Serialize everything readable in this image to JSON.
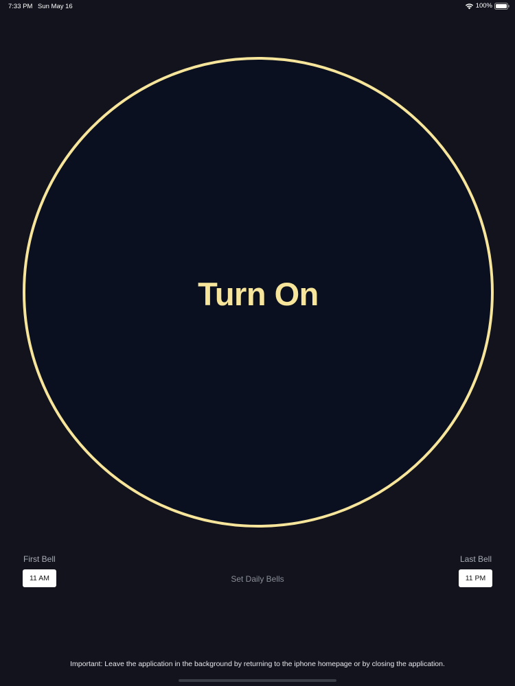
{
  "status_bar": {
    "time": "7:33 PM",
    "date": "Sun May 16",
    "battery": "100%",
    "wifi_icon": "wifi-icon",
    "battery_icon": "battery-icon"
  },
  "main": {
    "power_button_label": "Turn On",
    "accent_color": "#f6e59a",
    "background_color": "#12131c"
  },
  "bells": {
    "first_label": "First Bell",
    "first_value": "11 AM",
    "last_label": "Last Bell",
    "last_value": "11 PM",
    "set_daily_label": "Set Daily Bells"
  },
  "footer": {
    "note": "Important: Leave the application in the background by returning to the iphone homepage or by closing the application."
  }
}
